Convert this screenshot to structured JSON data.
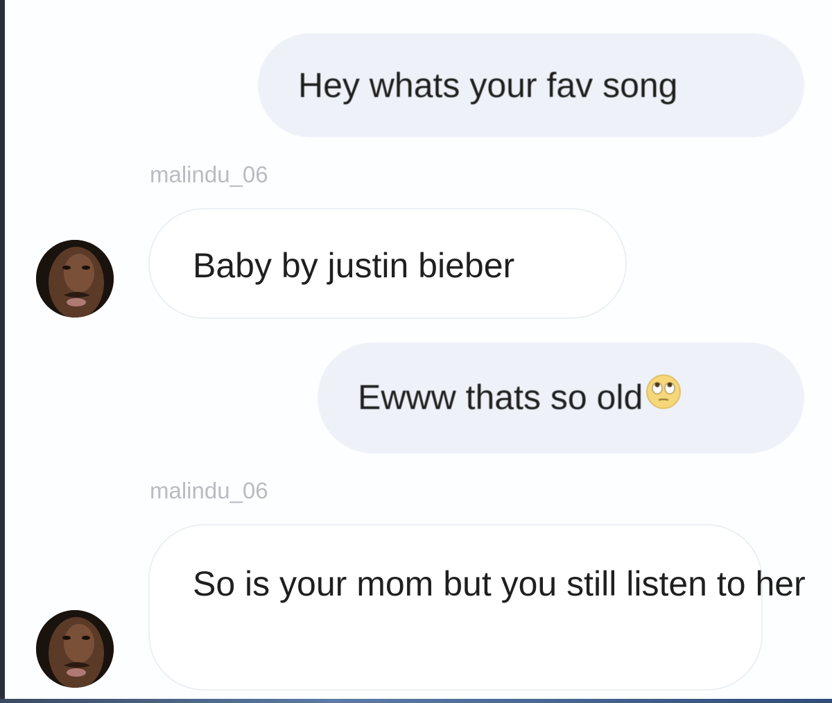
{
  "messages": [
    {
      "role": "outgoing",
      "text": "Hey whats your fav song"
    },
    {
      "role": "incoming",
      "username": "malindu_06",
      "text": "Baby by justin bieber"
    },
    {
      "role": "outgoing",
      "text": "Ewww thats so old",
      "emoji": "eye-roll-emoji"
    },
    {
      "role": "incoming",
      "username": "malindu_06",
      "lines": [
        "So is your mom but you still",
        "listen to her"
      ]
    }
  ],
  "colors": {
    "outgoing_bubble": "#eef2f8",
    "incoming_border": "#eceff3",
    "username": "#b8bcc3",
    "text": "#1f1f1f"
  }
}
